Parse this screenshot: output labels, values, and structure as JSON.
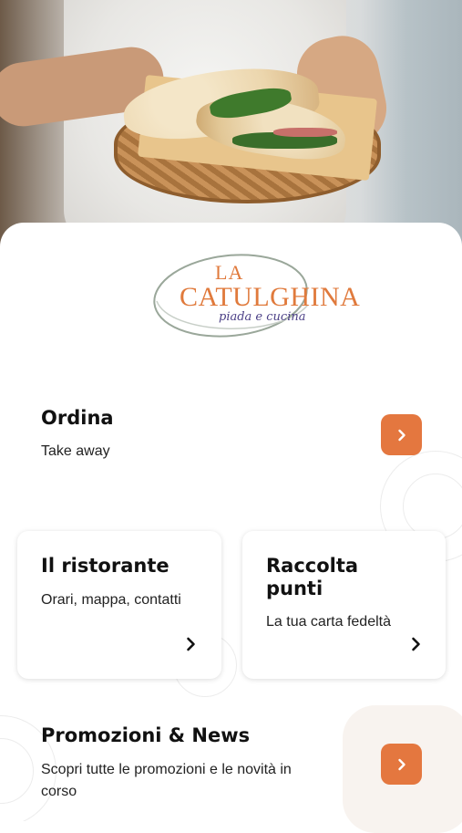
{
  "brand": {
    "logo_line1": "LA",
    "logo_line2": "CATULGHINA",
    "logo_tagline": "piada e cucina"
  },
  "ordina": {
    "title": "Ordina",
    "subtitle": "Take away",
    "action_icon": "chevron-right-icon"
  },
  "ristorante": {
    "title": "Il ristorante",
    "subtitle": "Orari, mappa, contatti",
    "action_icon": "chevron-right-icon"
  },
  "punti": {
    "title_line1": "Raccolta",
    "title_line2": "punti",
    "subtitle": "La tua carta fedeltà",
    "action_icon": "chevron-right-icon"
  },
  "promo": {
    "title": "Promozioni & News",
    "subtitle_line1": "Scopri tutte le promozioni e le novità in",
    "subtitle_line2": "corso",
    "action_icon": "chevron-right-icon"
  },
  "colors": {
    "accent": "#e4773f",
    "text": "#111111",
    "logo_orange": "#e07a3c",
    "logo_purple": "#4b3f86"
  }
}
